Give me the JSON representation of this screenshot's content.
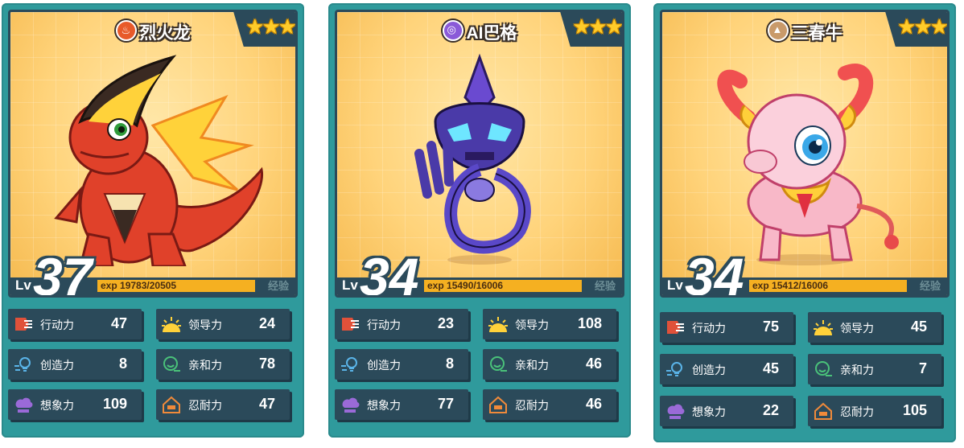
{
  "cards": [
    {
      "name": "烈火龙",
      "element_icon": "fire-element-icon",
      "element_color": "#e85a2a",
      "stars": "★★★",
      "level_prefix": "Lv",
      "level": "37",
      "exp_prefix": "exp",
      "exp_current": "19783",
      "exp_total": "/20505",
      "exp_label": "经验",
      "stats": [
        {
          "label": "行动力",
          "value": "47",
          "icon": "action-icon"
        },
        {
          "label": "领导力",
          "value": "24",
          "icon": "leadership-icon"
        },
        {
          "label": "创造力",
          "value": "8",
          "icon": "creativity-icon"
        },
        {
          "label": "亲和力",
          "value": "78",
          "icon": "affinity-icon"
        },
        {
          "label": "想象力",
          "value": "109",
          "icon": "imagination-icon"
        },
        {
          "label": "忍耐力",
          "value": "47",
          "icon": "endurance-icon"
        }
      ]
    },
    {
      "name": "AI巴格",
      "element_icon": "ai-element-icon",
      "element_color": "#8a5ad8",
      "stars": "★★★",
      "level_prefix": "Lv",
      "level": "34",
      "exp_prefix": "exp",
      "exp_current": "15490",
      "exp_total": "/16006",
      "exp_label": "经验",
      "stats": [
        {
          "label": "行动力",
          "value": "23",
          "icon": "action-icon"
        },
        {
          "label": "领导力",
          "value": "108",
          "icon": "leadership-icon"
        },
        {
          "label": "创造力",
          "value": "8",
          "icon": "creativity-icon"
        },
        {
          "label": "亲和力",
          "value": "46",
          "icon": "affinity-icon"
        },
        {
          "label": "想象力",
          "value": "77",
          "icon": "imagination-icon"
        },
        {
          "label": "忍耐力",
          "value": "46",
          "icon": "endurance-icon"
        }
      ]
    },
    {
      "name": "三春牛",
      "element_icon": "earth-element-icon",
      "element_color": "#c99a6a",
      "stars": "★★★",
      "level_prefix": "Lv",
      "level": "34",
      "exp_prefix": "exp",
      "exp_current": "15412",
      "exp_total": "/16006",
      "exp_label": "经验",
      "stats": [
        {
          "label": "行动力",
          "value": "75",
          "icon": "action-icon"
        },
        {
          "label": "领导力",
          "value": "45",
          "icon": "leadership-icon"
        },
        {
          "label": "创造力",
          "value": "45",
          "icon": "creativity-icon"
        },
        {
          "label": "亲和力",
          "value": "7",
          "icon": "affinity-icon"
        },
        {
          "label": "想象力",
          "value": "22",
          "icon": "imagination-icon"
        },
        {
          "label": "忍耐力",
          "value": "105",
          "icon": "endurance-icon"
        }
      ]
    }
  ]
}
